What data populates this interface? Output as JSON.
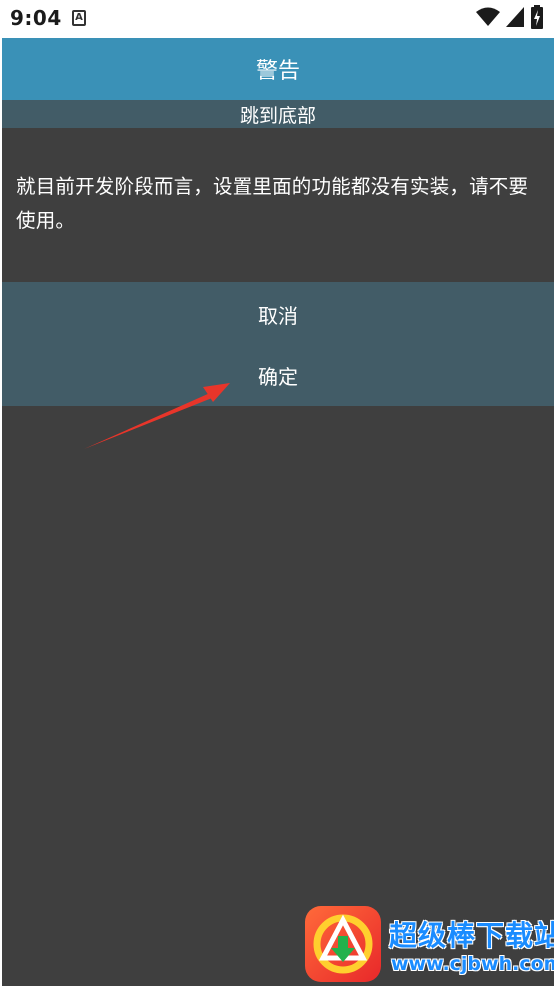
{
  "status_bar": {
    "time": "9:04",
    "notification_glyph": "A",
    "icons": [
      "wifi-icon",
      "signal-icon",
      "battery-icon"
    ]
  },
  "dialog": {
    "title": "警告",
    "jump_label": "跳到底部",
    "message": "就目前开发阶段而言，设置里面的功能都没有实装，请不要使用。",
    "cancel_label": "取消",
    "ok_label": "确定"
  },
  "watermark": {
    "title": "超级棒下载站",
    "url": "www.cjbwh.com"
  },
  "colors": {
    "title_bar": "#3a91b7",
    "jump_bar": "#425c67",
    "dialog_background": "#3f3f3f",
    "button_area": "#425c67",
    "annotation_arrow": "#e8352a",
    "watermark_text": "#1a8cff"
  }
}
